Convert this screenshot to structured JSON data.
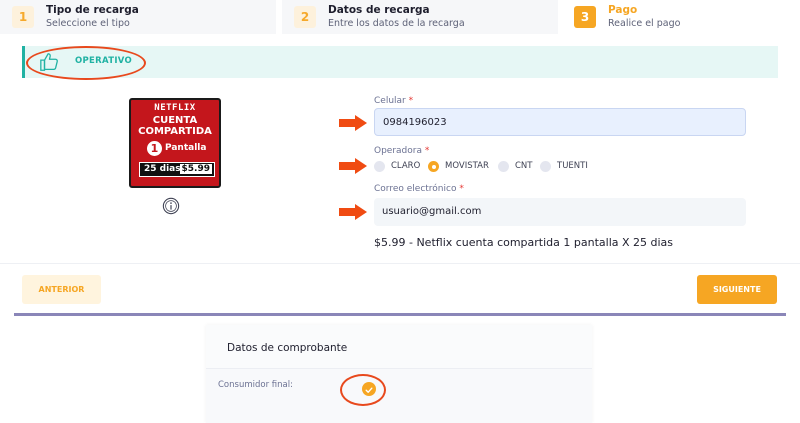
{
  "steps": [
    {
      "num": "1",
      "title": "Tipo de recarga",
      "subtitle": "Seleccione el tipo"
    },
    {
      "num": "2",
      "title": "Datos de recarga",
      "subtitle": "Entre los datos de la recarga"
    },
    {
      "num": "3",
      "title": "Pago",
      "subtitle": "Realice el pago"
    }
  ],
  "status": {
    "label": "OPERATIVO",
    "icon": "thumbs-up-icon"
  },
  "product": {
    "brand": "NETFLIX",
    "line1": "CUENTA",
    "line2": "COMPARTIDA",
    "qty": "1",
    "screens": "Pantalla",
    "days": "25 dias",
    "price": "$5.99"
  },
  "form": {
    "celular_label": "Celular",
    "celular_value": "0984196023",
    "operadora_label": "Operadora",
    "operadoras": [
      "CLARO",
      "MOVISTAR",
      "CNT",
      "TUENTI"
    ],
    "operadora_selected": "MOVISTAR",
    "correo_label": "Correo electrónico",
    "correo_value": "usuario@gmail.com",
    "required_mark": "*",
    "summary": "$5.99 - Netflix cuenta compartida 1 pantalla X 25 dias"
  },
  "buttons": {
    "prev": "ANTERIOR",
    "next": "SIGUIENTE"
  },
  "comprobante": {
    "title": "Datos de comprobante",
    "consumidor_label": "Consumidor final:",
    "consumidor_checked": true
  },
  "colors": {
    "accent": "#f6a623",
    "teal": "#20b2a3",
    "annotation": "#e8491d"
  }
}
